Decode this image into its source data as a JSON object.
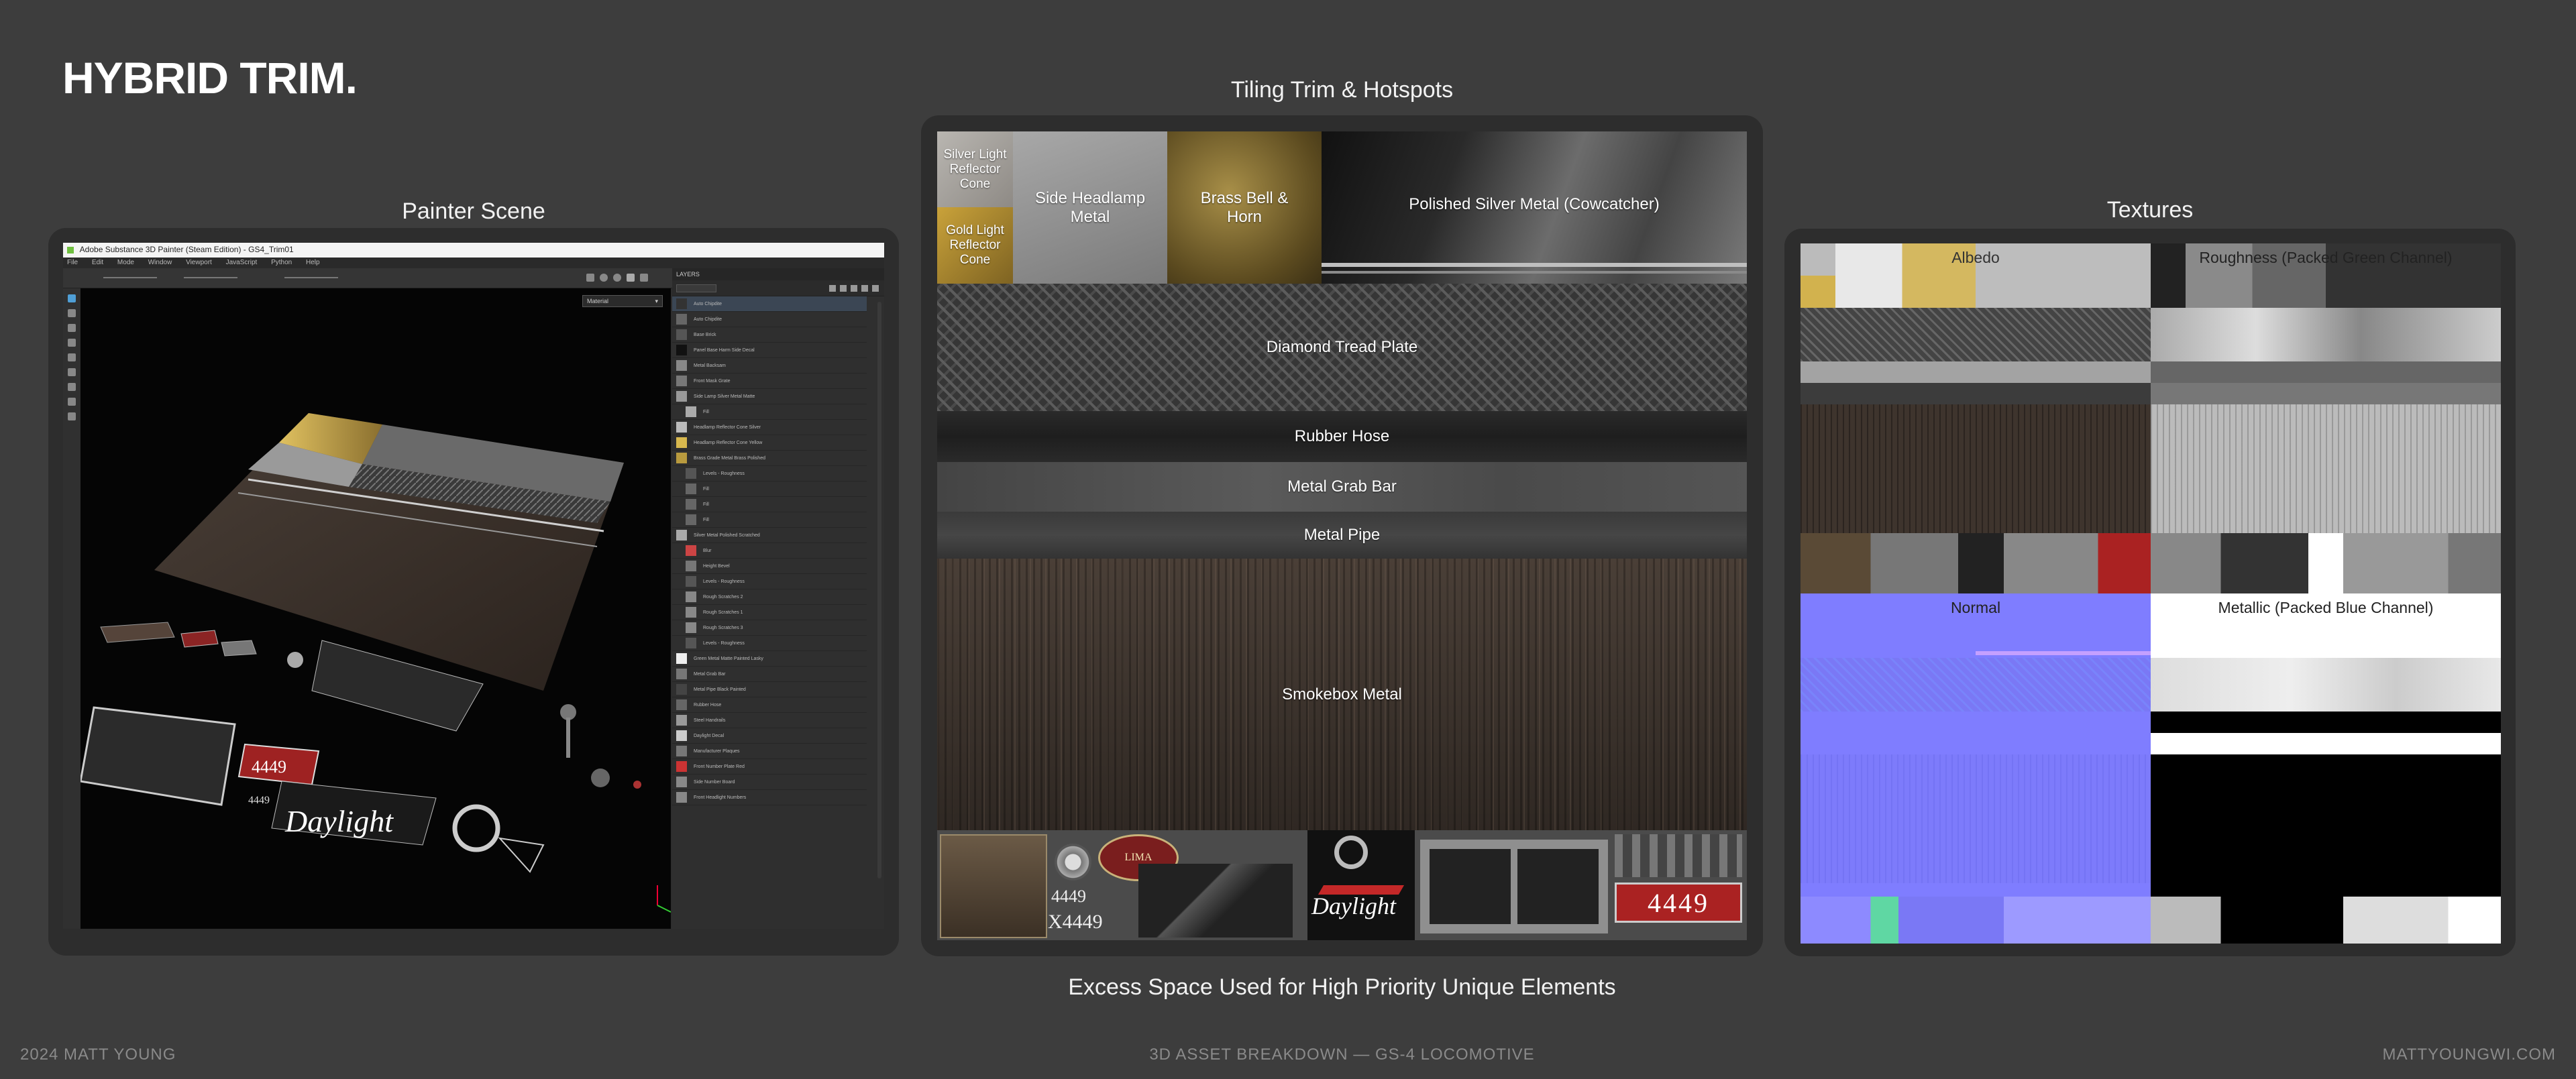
{
  "page": {
    "title": "HYBRID TRIM.",
    "footer_left": "2024 MATT YOUNG",
    "footer_center": "3D ASSET BREAKDOWN — GS-4 LOCOMOTIVE",
    "footer_right": "MATTYOUNGWI.COM"
  },
  "sections": {
    "painter_caption": "Painter Scene",
    "trim_caption": "Tiling Trim & Hotspots",
    "textures_caption": "Textures",
    "bottom_caption": "Excess Space Used for High Priority Unique Elements"
  },
  "painter": {
    "window_title": "Adobe Substance 3D Painter (Steam Edition) - GS4_Trim01",
    "menu": [
      "File",
      "Edit",
      "Mode",
      "Window",
      "Viewport",
      "JavaScript",
      "Python",
      "Help"
    ],
    "layers_title": "LAYERS",
    "viewport_mode": "Material",
    "layers": [
      "Auto Chipdite",
      "Auto Chipdite",
      "Base Brick",
      "Panel Base Harm Side Decal",
      "Metal Backsam",
      "Front Mask Grate",
      "Side Lamp Silver Metal Matte",
      "Fill",
      "Headlamp Reflector Cone Silver",
      "Headlamp Reflector Cone Yellow",
      "Brass Grade Metal Brass Polished",
      "Levels - Roughness",
      "Fill",
      "Fill",
      "Fill",
      "Silver Metal Polished Scratched",
      "Blur",
      "Height Bevel",
      "Levels - Roughness",
      "Rough Scratches 2",
      "Rough Scratches 1",
      "Rough Scratches 3",
      "Levels - Roughness",
      "Green Metal Matte Painted Lasky",
      "Metal Grab Bar",
      "Metal Pipe Black Painted",
      "Rubber Hose",
      "Steel Handrails",
      "Daylight Decal",
      "Manufacturer Plaques",
      "Front Number Plate Red",
      "Side Number Board",
      "Front Headlight Numbers"
    ],
    "decal_number": "4449",
    "decal_brand": "Daylight"
  },
  "trim": {
    "cells": {
      "silver_cone": "Silver Light Reflector Cone",
      "gold_cone": "Gold Light Reflector Cone",
      "side_headlamp": "Side Headlamp Metal",
      "brass": "Brass Bell & Horn",
      "polished": "Polished Silver Metal (Cowcatcher)",
      "diamond": "Diamond Tread Plate",
      "rubber": "Rubber Hose",
      "grab": "Metal Grab Bar",
      "pipe": "Metal Pipe",
      "smokebox": "Smokebox Metal"
    },
    "unique": {
      "plaque": "LIMA",
      "number_a": "4449",
      "number_b": "X4449",
      "brand": "Daylight",
      "red_plate": "4449"
    }
  },
  "textures": {
    "albedo": "Albedo",
    "roughness": "Roughness (Packed Green Channel)",
    "normal": "Normal",
    "metallic": "Metallic (Packed Blue Channel)"
  }
}
